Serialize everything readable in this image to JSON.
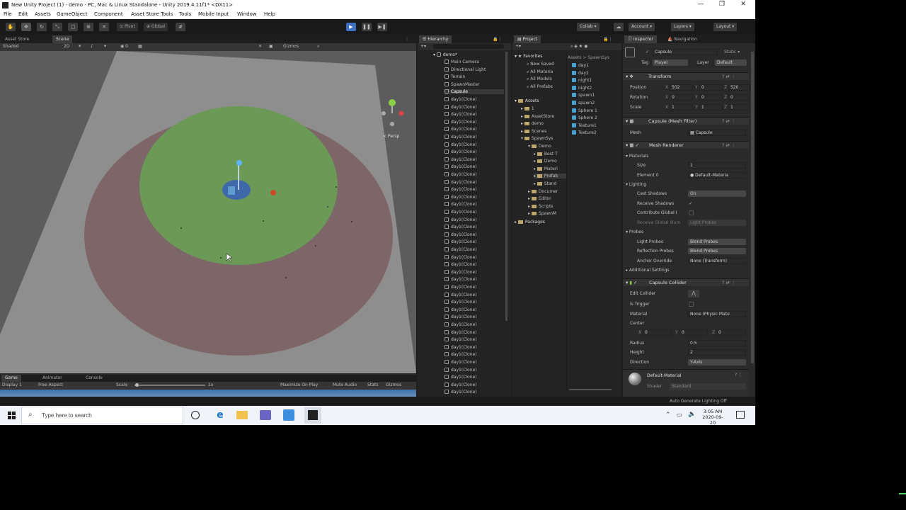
{
  "window": {
    "title": "New Unity Project (1) - demo - PC, Mac & Linux Standalone - Unity 2019.4.11f1* <DX11>",
    "controls": [
      "—",
      "❐",
      "✕"
    ]
  },
  "menu": [
    "File",
    "Edit",
    "Assets",
    "GameObject",
    "Component",
    "Asset Store Tools",
    "Tools",
    "Mobile Input",
    "Window",
    "Help"
  ],
  "toolbar": {
    "pivot_label": "Pivot",
    "global_label": "Global",
    "play": "▶",
    "pause": "❚❚",
    "step": "▶❚",
    "collab": "Collab ▾",
    "account": "Account ▾",
    "layers": "Layers ▾",
    "layout": "Layout ▾"
  },
  "scene": {
    "tabs": [
      "Asset Store",
      "Scene"
    ],
    "shading": "Shaded",
    "mode_2d": "2D",
    "gizmos": "Gizmos",
    "persp_label": "< Persp"
  },
  "game": {
    "tabs": [
      "Game",
      "Animator",
      "Console"
    ],
    "display": "Display 1",
    "aspect": "Free Aspect",
    "scale_label": "Scale",
    "scale_value": "1x",
    "maximize": "Maximize On Play",
    "mute": "Mute Audio",
    "stats": "Stats",
    "gizmos": "Gizmos"
  },
  "hierarchy": {
    "tab": "Hierarchy",
    "scene_name": "demo*",
    "items": [
      "Main Camera",
      "Directional Light",
      "Terrain",
      "SpawnMaster",
      "Capsule",
      "day1(Clone)",
      "day1(Clone)",
      "day1(Clone)",
      "day1(Clone)",
      "day1(Clone)",
      "day1(Clone)",
      "day1(Clone)",
      "day1(Clone)",
      "day1(Clone)",
      "day1(Clone)",
      "day1(Clone)",
      "day1(Clone)",
      "day1(Clone)",
      "day1(Clone)",
      "day1(Clone)",
      "day1(Clone)",
      "day1(Clone)",
      "day1(Clone)",
      "day1(Clone)",
      "day1(Clone)",
      "day1(Clone)",
      "day1(Clone)",
      "day1(Clone)",
      "day1(Clone)",
      "day1(Clone)",
      "day1(Clone)",
      "day1(Clone)",
      "day1(Clone)",
      "day1(Clone)",
      "day1(Clone)",
      "day1(Clone)",
      "day1(Clone)",
      "day1(Clone)",
      "day1(Clone)",
      "day1(Clone)",
      "day1(Clone)",
      "day1(Clone)",
      "day1(Clone)",
      "day1(Clone)",
      "day1(Clone)",
      "day1(Clone)",
      "day1(Clone)",
      "day1(Clone)",
      "day1(Clone)",
      "day1(Clone)",
      "day1(Clone)"
    ],
    "selected_index": 4
  },
  "project": {
    "tab": "Project",
    "breadcrumb": "Assets > SpawnSys",
    "favorites_label": "Favorites",
    "favorites": [
      "New Saved",
      "All Materia",
      "All Models",
      "All Prefabs"
    ],
    "assets_label": "Assets",
    "assets": [
      "1",
      "AssetStore",
      "demo",
      "Scenes",
      "SpawnSys"
    ],
    "spawn_children": [
      "Demo",
      "Best T",
      "Demo",
      "Materi",
      "Prefab",
      "Stand"
    ],
    "assets_after": [
      "Documer",
      "Editor",
      "Scripts",
      "SpawnM"
    ],
    "packages_label": "Packages",
    "files": [
      "day1",
      "day2",
      "night1",
      "night2",
      "spawn1",
      "spawn2",
      "Sphere 1",
      "Sphere 2",
      "Texture1",
      "Texture2"
    ]
  },
  "inspector": {
    "tabs": [
      "Inspector",
      "Navigation"
    ],
    "object_name": "Capsule",
    "static_label": "Static ▾",
    "tag_label": "Tag",
    "tag_value": "Player",
    "layer_label": "Layer",
    "layer_value": "Default",
    "transform": {
      "header": "Transform",
      "position_label": "Position",
      "rotation_label": "Rotation",
      "scale_label": "Scale",
      "pos_x": "502",
      "pos_y": "0",
      "pos_z": "520",
      "rot_x": "0",
      "rot_y": "0",
      "rot_z": "0",
      "scl_x": "1",
      "scl_y": "1",
      "scl_z": "1"
    },
    "mesh_filter": {
      "header": "Capsule (Mesh Filter)",
      "mesh_label": "Mesh",
      "mesh_value": "Capsule"
    },
    "mesh_renderer": {
      "header": "Mesh Renderer",
      "materials_label": "Materials",
      "size_label": "Size",
      "size_value": "1",
      "element_label": "Element 0",
      "element_value": "Default-Materia",
      "lighting_label": "Lighting",
      "cast_shadows_label": "Cast Shadows",
      "cast_shadows_value": "On",
      "receive_shadows_label": "Receive Shadows",
      "receive_shadows_value": "✓",
      "contribute_gi_label": "Contribute Global I",
      "receive_gi_label": "Receive Global Illum",
      "receive_gi_value": "Light Probes",
      "probes_label": "Probes",
      "light_probes_label": "Light Probes",
      "light_probes_value": "Blend Probes",
      "reflection_probes_label": "Reflection Probes",
      "reflection_probes_value": "Blend Probes",
      "anchor_override_label": "Anchor Override",
      "anchor_override_value": "None (Transform)",
      "additional_label": "Additional Settings"
    },
    "capsule_collider": {
      "header": "Capsule Collider",
      "edit_collider_label": "Edit Collider",
      "is_trigger_label": "Is Trigger",
      "material_label": "Material",
      "material_value": "None (Physic Mate",
      "center_label": "Center",
      "center_x": "0",
      "center_y": "0",
      "center_z": "0",
      "radius_label": "Radius",
      "radius_value": "0.5",
      "height_label": "Height",
      "height_value": "2",
      "direction_label": "Direction",
      "direction_value": "Y-Axis"
    },
    "material": {
      "name": "Default-Material",
      "shader_label": "Shader",
      "shader_value": "Standard"
    }
  },
  "status": {
    "text": "Auto Generate Lighting Off"
  },
  "taskbar": {
    "search_placeholder": "Type here to search",
    "time": "3:05 AM",
    "date": "2020-09-20"
  },
  "colors": {
    "play_active": "#3d6fc2",
    "inner_zone": "#6a9a56",
    "outer_zone": "#7a5f62",
    "plane": "#8c8c8c",
    "accent_tray": "#4fd06b"
  }
}
